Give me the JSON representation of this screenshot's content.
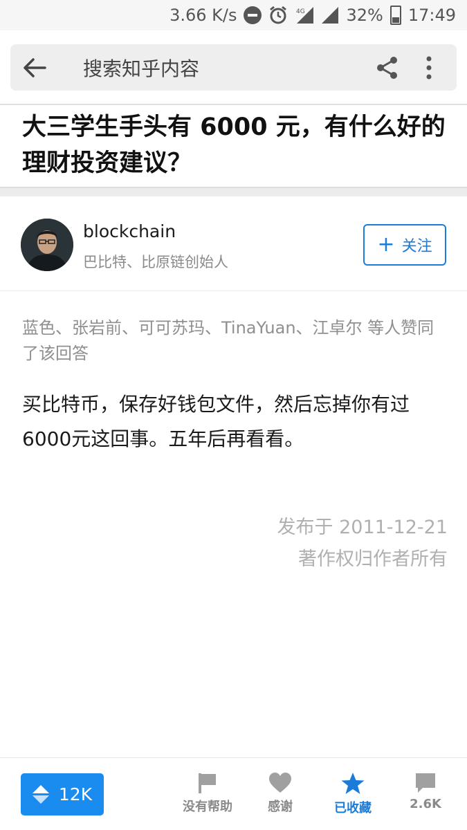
{
  "status_bar": {
    "speed": "3.66 K/s",
    "network": "4G",
    "battery": "32%",
    "time": "17:49"
  },
  "search": {
    "placeholder": "搜索知乎内容"
  },
  "question": {
    "title": "大三学生手头有 6000 元，有什么好的理财投资建议？"
  },
  "author": {
    "name": "blockchain",
    "bio": "巴比特、比原链创始人",
    "follow_label": "关注"
  },
  "answer": {
    "voters": "蓝色、张岩前、可可苏玛、TinaYuan、江卓尔 等人赞同了该回答",
    "content": "买比特币，保存好钱包文件，然后忘掉你有过6000元这回事。五年后再看看。",
    "published": "发布于 2011-12-21",
    "copyright": "著作权归作者所有"
  },
  "bottom_bar": {
    "vote_count": "12K",
    "no_help_label": "没有帮助",
    "thanks_label": "感谢",
    "favorited_label": "已收藏",
    "comment_count": "2.6K",
    "accent_color": "#1a7bd8"
  }
}
